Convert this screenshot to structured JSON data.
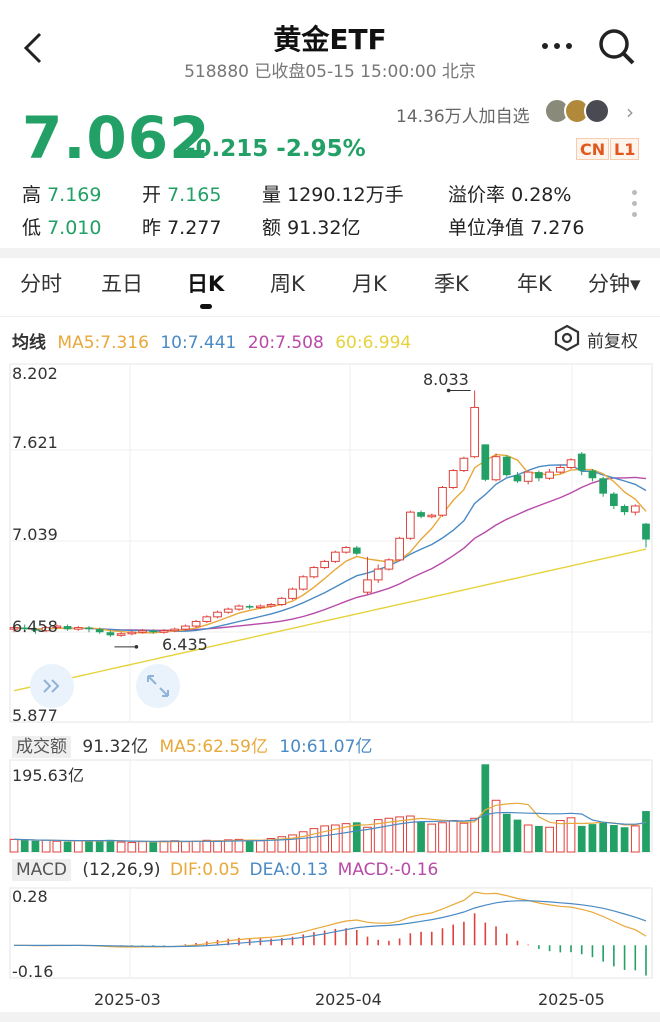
{
  "header": {
    "title": "黄金ETF",
    "subtitle": "518880 已收盘05-15 15:00:00 北京"
  },
  "quote": {
    "price": "7.062",
    "change": "-0.215 -2.95%",
    "watchers": "14.36万人加自选",
    "tags": [
      "CN",
      "L1"
    ],
    "up_color": "#e0413b",
    "down_color": "#22a065"
  },
  "stats": {
    "high_label": "高",
    "high": "7.169",
    "open_label": "开",
    "open": "7.165",
    "vol_label": "量",
    "vol": "1290.12万手",
    "prem_label": "溢价率",
    "prem": "0.28%",
    "low_label": "低",
    "low": "7.010",
    "prev_label": "昨",
    "prev": "7.277",
    "amt_label": "额",
    "amt": "91.32亿",
    "nav_label": "单位净值",
    "nav": "7.276"
  },
  "tabs": [
    "分时",
    "五日",
    "日K",
    "周K",
    "月K",
    "季K",
    "年K",
    "分钟▾"
  ],
  "active_tab": "日K",
  "ma_legend": {
    "label": "均线",
    "ma5": "MA5:7.316",
    "ma10": "10:7.441",
    "ma20": "20:7.508",
    "ma60": "60:6.994",
    "colors": {
      "ma5": "#e8a83a",
      "ma10": "#4a8ac4",
      "ma20": "#b84aa8",
      "ma60": "#e6d23a"
    }
  },
  "adjust_label": "前复权",
  "price_axis": {
    "ticks": [
      "8.202",
      "7.621",
      "7.039",
      "6.458",
      "5.877"
    ],
    "max_marker": "8.033",
    "min_marker": "6.435"
  },
  "volume_legend": {
    "label": "成交额",
    "value": "91.32亿",
    "ma5": "MA5:62.59亿",
    "ma10": "10:61.07亿",
    "top": "195.63亿"
  },
  "macd_legend": {
    "label": "MACD",
    "params": "(12,26,9)",
    "dif": "DIF:0.05",
    "dea": "DEA:0.13",
    "macd": "MACD:-0.16",
    "top": "0.28",
    "bottom": "-0.16"
  },
  "x_axis": [
    "2025-03",
    "2025-04",
    "2025-05"
  ],
  "chart_data": {
    "type": "candlestick",
    "ylim": [
      5.877,
      8.202
    ],
    "candles": [
      [
        6.48,
        6.49,
        6.46,
        6.5
      ],
      [
        6.49,
        6.48,
        6.46,
        6.51
      ],
      [
        6.48,
        6.47,
        6.45,
        6.49
      ],
      [
        6.47,
        6.49,
        6.46,
        6.5
      ],
      [
        6.49,
        6.5,
        6.48,
        6.51
      ],
      [
        6.5,
        6.48,
        6.47,
        6.51
      ],
      [
        6.48,
        6.49,
        6.47,
        6.5
      ],
      [
        6.49,
        6.48,
        6.46,
        6.5
      ],
      [
        6.48,
        6.46,
        6.45,
        6.49
      ],
      [
        6.46,
        6.44,
        6.43,
        6.47
      ],
      [
        6.44,
        6.45,
        6.43,
        6.46
      ],
      [
        6.45,
        6.46,
        6.44,
        6.47
      ],
      [
        6.46,
        6.47,
        6.45,
        6.48
      ],
      [
        6.47,
        6.46,
        6.45,
        6.48
      ],
      [
        6.46,
        6.47,
        6.45,
        6.48
      ],
      [
        6.47,
        6.48,
        6.46,
        6.49
      ],
      [
        6.48,
        6.5,
        6.47,
        6.51
      ],
      [
        6.5,
        6.53,
        6.49,
        6.54
      ],
      [
        6.53,
        6.56,
        6.52,
        6.57
      ],
      [
        6.56,
        6.59,
        6.55,
        6.6
      ],
      [
        6.59,
        6.61,
        6.58,
        6.62
      ],
      [
        6.61,
        6.63,
        6.6,
        6.64
      ],
      [
        6.63,
        6.62,
        6.61,
        6.64
      ],
      [
        6.62,
        6.63,
        6.61,
        6.64
      ],
      [
        6.63,
        6.64,
        6.62,
        6.65
      ],
      [
        6.64,
        6.68,
        6.63,
        6.69
      ],
      [
        6.68,
        6.74,
        6.67,
        6.75
      ],
      [
        6.74,
        6.82,
        6.73,
        6.83
      ],
      [
        6.82,
        6.88,
        6.81,
        6.89
      ],
      [
        6.88,
        6.92,
        6.87,
        6.93
      ],
      [
        6.92,
        6.98,
        6.91,
        6.99
      ],
      [
        6.98,
        7.01,
        6.97,
        7.02
      ],
      [
        7.01,
        6.97,
        6.96,
        7.02
      ],
      [
        6.72,
        6.8,
        6.7,
        6.95
      ],
      [
        6.8,
        6.87,
        6.78,
        6.9
      ],
      [
        6.87,
        6.93,
        6.86,
        6.94
      ],
      [
        6.93,
        7.07,
        6.92,
        7.08
      ],
      [
        7.07,
        7.24,
        7.06,
        7.25
      ],
      [
        7.24,
        7.21,
        7.2,
        7.25
      ],
      [
        7.21,
        7.22,
        7.2,
        7.23
      ],
      [
        7.22,
        7.4,
        7.21,
        7.41
      ],
      [
        7.4,
        7.51,
        7.39,
        7.52
      ],
      [
        7.51,
        7.59,
        7.5,
        7.6
      ],
      [
        7.6,
        7.92,
        7.59,
        8.03
      ],
      [
        7.68,
        7.45,
        7.44,
        7.68
      ],
      [
        7.45,
        7.6,
        7.44,
        7.62
      ],
      [
        7.6,
        7.48,
        7.47,
        7.61
      ],
      [
        7.48,
        7.44,
        7.43,
        7.5
      ],
      [
        7.44,
        7.5,
        7.42,
        7.51
      ],
      [
        7.5,
        7.46,
        7.44,
        7.51
      ],
      [
        7.46,
        7.5,
        7.45,
        7.52
      ],
      [
        7.5,
        7.53,
        7.49,
        7.55
      ],
      [
        7.53,
        7.58,
        7.52,
        7.59
      ],
      [
        7.62,
        7.51,
        7.48,
        7.63
      ],
      [
        7.51,
        7.46,
        7.44,
        7.52
      ],
      [
        7.46,
        7.36,
        7.34,
        7.47
      ],
      [
        7.36,
        7.28,
        7.26,
        7.37
      ],
      [
        7.28,
        7.24,
        7.22,
        7.29
      ],
      [
        7.24,
        7.28,
        7.22,
        7.29
      ],
      [
        7.165,
        7.062,
        7.01,
        7.169
      ]
    ],
    "volumes": [
      28,
      27,
      25,
      26,
      24,
      23,
      25,
      24,
      26,
      27,
      22,
      21,
      23,
      22,
      24,
      25,
      23,
      24,
      26,
      25,
      27,
      28,
      26,
      25,
      30,
      34,
      38,
      45,
      52,
      58,
      60,
      63,
      66,
      55,
      72,
      75,
      78,
      80,
      68,
      62,
      65,
      70,
      64,
      75,
      195,
      115,
      85,
      72,
      60,
      58,
      55,
      70,
      76,
      58,
      62,
      66,
      60,
      55,
      58,
      91
    ]
  }
}
